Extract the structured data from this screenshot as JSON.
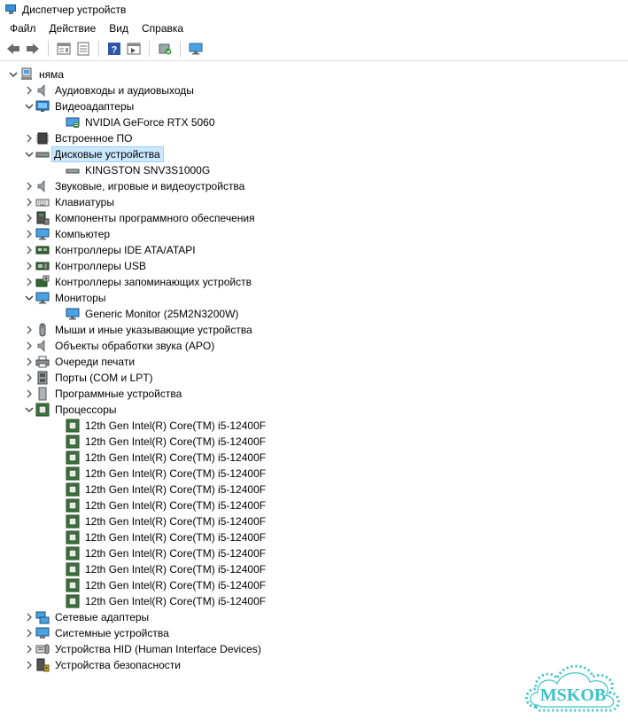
{
  "window": {
    "title": "Диспетчер устройств"
  },
  "menu": [
    "Файл",
    "Действие",
    "Вид",
    "Справка"
  ],
  "toolbar_icons": [
    "back-arrow-icon",
    "forward-arrow-icon",
    "properties-icon",
    "update-driver-icon",
    "help-icon",
    "scan-hardware-icon",
    "device-icon",
    "monitor-icon"
  ],
  "tree": {
    "root": "няма",
    "categories": [
      {
        "label": "Аудиовходы и аудиовыходы",
        "icon": "speaker-icon",
        "expanded": false
      },
      {
        "label": "Видеоадаптеры",
        "icon": "display-adapter-icon",
        "expanded": true,
        "children": [
          "NVIDIA GeForce RTX 5060"
        ]
      },
      {
        "label": "Встроенное ПО",
        "icon": "firmware-icon",
        "expanded": false
      },
      {
        "label": "Дисковые устройства",
        "icon": "disk-drive-icon",
        "expanded": true,
        "selected": true,
        "children": [
          "KINGSTON SNV3S1000G"
        ]
      },
      {
        "label": "Звуковые, игровые и видеоустройства",
        "icon": "speaker-icon",
        "expanded": false
      },
      {
        "label": "Клавиатуры",
        "icon": "keyboard-icon",
        "expanded": false
      },
      {
        "label": "Компоненты программного обеспечения",
        "icon": "software-component-icon",
        "expanded": false
      },
      {
        "label": "Компьютер",
        "icon": "computer-icon",
        "expanded": false
      },
      {
        "label": "Контроллеры IDE ATA/ATAPI",
        "icon": "ide-controller-icon",
        "expanded": false
      },
      {
        "label": "Контроллеры USB",
        "icon": "usb-controller-icon",
        "expanded": false
      },
      {
        "label": "Контроллеры запоминающих устройств",
        "icon": "storage-controller-icon",
        "expanded": false
      },
      {
        "label": "Мониторы",
        "icon": "monitor-icon",
        "expanded": true,
        "children": [
          "Generic Monitor (25M2N3200W)"
        ]
      },
      {
        "label": "Мыши и иные указывающие устройства",
        "icon": "mouse-icon",
        "expanded": false
      },
      {
        "label": "Объекты обработки звука (APO)",
        "icon": "speaker-icon",
        "expanded": false
      },
      {
        "label": "Очереди печати",
        "icon": "printer-icon",
        "expanded": false
      },
      {
        "label": "Порты (COM и LPT)",
        "icon": "port-icon",
        "expanded": false
      },
      {
        "label": "Программные устройства",
        "icon": "software-device-icon",
        "expanded": false
      },
      {
        "label": "Процессоры",
        "icon": "processor-icon",
        "expanded": true,
        "children": [
          "12th Gen Intel(R) Core(TM) i5-12400F",
          "12th Gen Intel(R) Core(TM) i5-12400F",
          "12th Gen Intel(R) Core(TM) i5-12400F",
          "12th Gen Intel(R) Core(TM) i5-12400F",
          "12th Gen Intel(R) Core(TM) i5-12400F",
          "12th Gen Intel(R) Core(TM) i5-12400F",
          "12th Gen Intel(R) Core(TM) i5-12400F",
          "12th Gen Intel(R) Core(TM) i5-12400F",
          "12th Gen Intel(R) Core(TM) i5-12400F",
          "12th Gen Intel(R) Core(TM) i5-12400F",
          "12th Gen Intel(R) Core(TM) i5-12400F",
          "12th Gen Intel(R) Core(TM) i5-12400F"
        ]
      },
      {
        "label": "Сетевые адаптеры",
        "icon": "network-adapter-icon",
        "expanded": false
      },
      {
        "label": "Системные устройства",
        "icon": "system-device-icon",
        "expanded": false
      },
      {
        "label": "Устройства HID (Human Interface Devices)",
        "icon": "hid-icon",
        "expanded": false
      },
      {
        "label": "Устройства безопасности",
        "icon": "security-device-icon",
        "expanded": false
      }
    ]
  },
  "watermark": {
    "text": "MSKOB",
    "color": "#3cc3c8"
  }
}
